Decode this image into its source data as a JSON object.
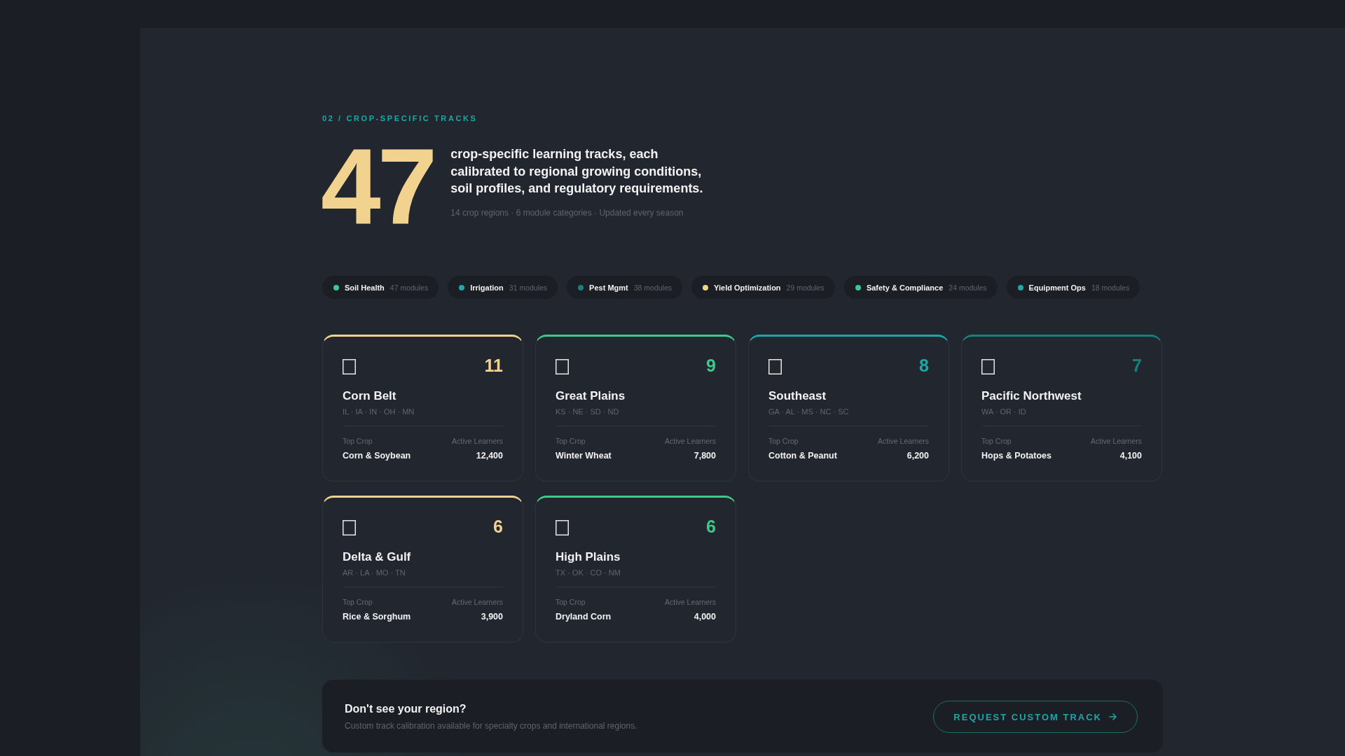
{
  "section_label": "02 / CROP-SPECIFIC TRACKS",
  "hero": {
    "count": "47",
    "description": "crop-specific learning tracks, each calibrated to regional growing conditions, soil profiles, and regulatory requirements.",
    "meta": "14 crop regions · 6 module categories · Updated every season"
  },
  "categories": [
    {
      "name": "Soil Health",
      "count": "47 modules",
      "color": "#3ec98c"
    },
    {
      "name": "Irrigation",
      "count": "31 modules",
      "color": "#1fa6a6"
    },
    {
      "name": "Pest Mgmt",
      "count": "38 modules",
      "color": "#17807d"
    },
    {
      "name": "Yield Optimization",
      "count": "29 modules",
      "color": "#f2d28f"
    },
    {
      "name": "Safety & Compliance",
      "count": "24 modules",
      "color": "#3ec98c"
    },
    {
      "name": "Equipment Ops",
      "count": "18 modules",
      "color": "#1fa6a6"
    }
  ],
  "regions": [
    {
      "name": "Corn Belt",
      "count": "11",
      "states": "IL · IA · IN · OH · MN",
      "top_crop_label": "Top Crop",
      "top_crop": "Corn & Soybean",
      "learners_label": "Active Learners",
      "learners": "12,400",
      "color": "#f2d28f"
    },
    {
      "name": "Great Plains",
      "count": "9",
      "states": "KS · NE · SD · ND",
      "top_crop_label": "Top Crop",
      "top_crop": "Winter Wheat",
      "learners_label": "Active Learners",
      "learners": "7,800",
      "color": "#3ec98c"
    },
    {
      "name": "Southeast",
      "count": "8",
      "states": "GA · AL · MS · NC · SC",
      "top_crop_label": "Top Crop",
      "top_crop": "Cotton & Peanut",
      "learners_label": "Active Learners",
      "learners": "6,200",
      "color": "#1fa6a6"
    },
    {
      "name": "Pacific Northwest",
      "count": "7",
      "states": "WA · OR · ID",
      "top_crop_label": "Top Crop",
      "top_crop": "Hops & Potatoes",
      "learners_label": "Active Learners",
      "learners": "4,100",
      "color": "#17807d"
    },
    {
      "name": "Delta & Gulf",
      "count": "6",
      "states": "AR · LA · MO · TN",
      "top_crop_label": "Top Crop",
      "top_crop": "Rice & Sorghum",
      "learners_label": "Active Learners",
      "learners": "3,900",
      "color": "#f2d28f"
    },
    {
      "name": "High Plains",
      "count": "6",
      "states": "TX · OK · CO · NM",
      "top_crop_label": "Top Crop",
      "top_crop": "Dryland Corn",
      "learners_label": "Active Learners",
      "learners": "4,000",
      "color": "#3ec98c"
    }
  ],
  "cta": {
    "title": "Don't see your region?",
    "text": "Custom track calibration available for specialty crops and international regions.",
    "button": "REQUEST CUSTOM TRACK"
  }
}
